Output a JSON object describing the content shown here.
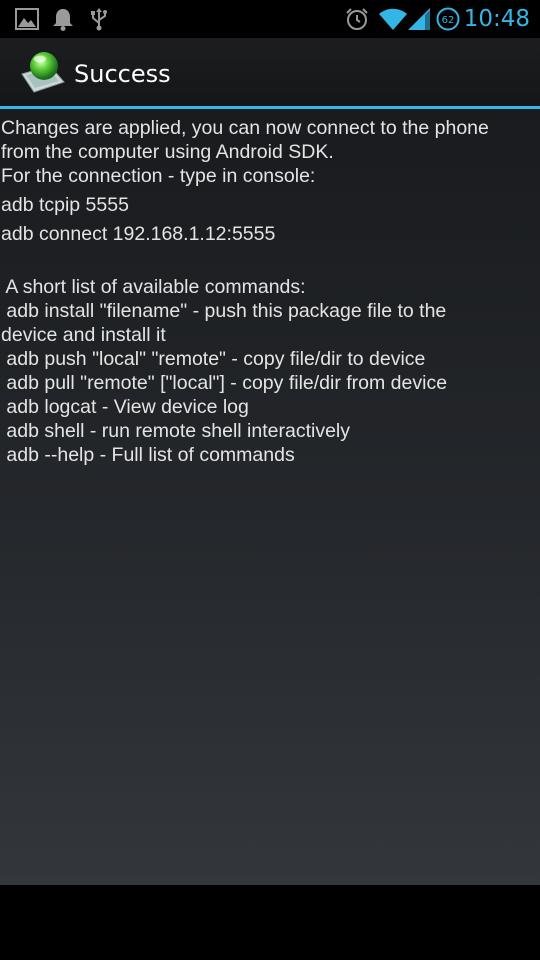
{
  "status_bar": {
    "time": "10:48",
    "battery_level": "62",
    "accent_color": "#33b5e5",
    "icons_left": [
      "image-notification-icon",
      "bell-notification-icon",
      "usb-icon"
    ],
    "icons_right": [
      "alarm-clock-icon",
      "wifi-icon",
      "signal-icon",
      "battery-icon"
    ]
  },
  "dialog": {
    "title": "Success",
    "lines": [
      "Changes are applied, you can now connect to the phone",
      "from the computer using Android SDK.",
      "For the connection - type in console:",
      "adb tcpip 5555",
      "adb connect 192.168.1.12:5555",
      " A short list of available commands:",
      " adb install \"filename\" - push this package file to the",
      "device and install it",
      " adb push \"local\" \"remote\" - copy file/dir to device",
      " adb pull \"remote\" [\"local\"] - copy file/dir from device",
      " adb logcat - View device log",
      " adb shell - run remote shell interactively",
      " adb --help - Full list of commands"
    ]
  }
}
